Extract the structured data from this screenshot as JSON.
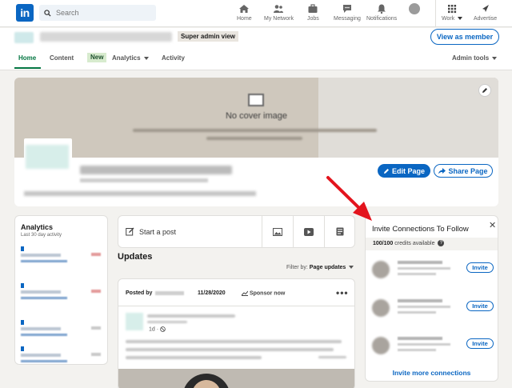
{
  "nav": {
    "logo": "in",
    "search_placeholder": "Search",
    "items": [
      {
        "label": "Home"
      },
      {
        "label": "My Network"
      },
      {
        "label": "Jobs"
      },
      {
        "label": "Messaging"
      },
      {
        "label": "Notifications"
      },
      {
        "label": "Work"
      },
      {
        "label": "Advertise"
      }
    ]
  },
  "header": {
    "badge": "Super admin view",
    "view_as_member": "View as member",
    "tabs": [
      "Home",
      "Content",
      "Analytics",
      "Activity"
    ],
    "new_badge": "New",
    "admin_tools": "Admin tools"
  },
  "cover": {
    "no_cover": "No cover image",
    "edit_page": "Edit Page",
    "share_page": "Share Page"
  },
  "analytics": {
    "title": "Analytics",
    "subtitle": "Last 30 day activity"
  },
  "composer": {
    "start_post": "Start a post"
  },
  "feed": {
    "updates_title": "Updates",
    "filter_label": "Filter by:",
    "filter_value": "Page updates",
    "posted_by": "Posted by",
    "date": "11/28/2020",
    "sponsor": "Sponsor now",
    "post_age": "1d"
  },
  "invite": {
    "title": "Invite Connections To Follow",
    "credits": "100/100",
    "credits_suffix": "credits available",
    "invite_label": "Invite",
    "more": "Invite more connections"
  },
  "colors": {
    "brand": "#0a66c2",
    "active_tab": "#057642",
    "arrow": "#e3141d"
  }
}
